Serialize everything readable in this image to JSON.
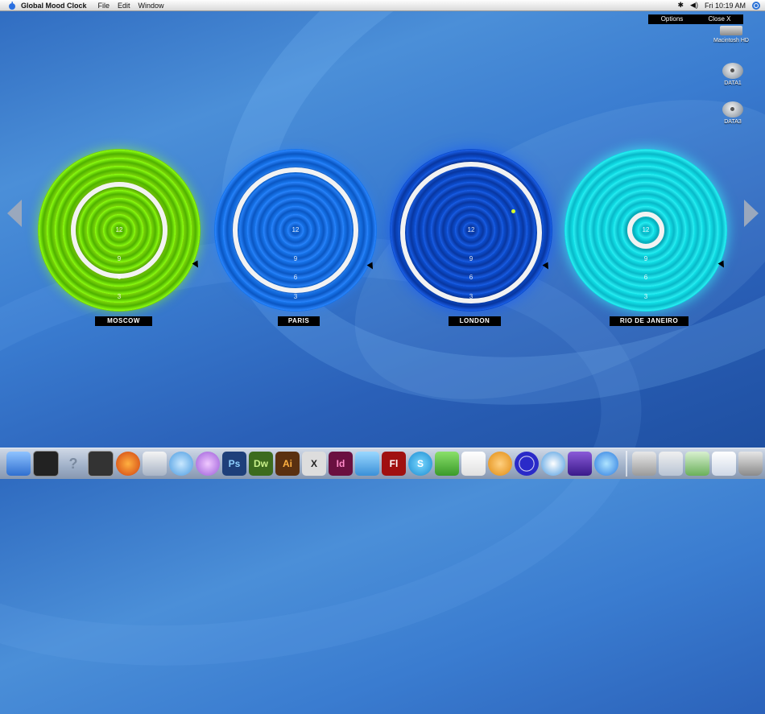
{
  "menubar": {
    "app_name": "Global Mood Clock",
    "menus": [
      "File",
      "Edit",
      "Window"
    ],
    "clock_text": "Fri 10:19 AM"
  },
  "controls": {
    "options_label": "Options",
    "close_label": "Close X"
  },
  "desktop_icons": [
    {
      "label": "Macintosh HD",
      "icon": "hard-drive-icon"
    },
    {
      "label": "DATA1",
      "icon": "disk-icon"
    },
    {
      "label": "DATA3",
      "icon": "disk-icon"
    }
  ],
  "clocks": [
    {
      "city": "MOSCOW",
      "numbers": [
        "12",
        "9",
        "6",
        "3"
      ],
      "color": "#7ed80a"
    },
    {
      "city": "PARIS",
      "numbers": [
        "12",
        "9",
        "6",
        "3"
      ],
      "color": "#1a78ef"
    },
    {
      "city": "LONDON",
      "numbers": [
        "12",
        "9",
        "6",
        "3"
      ],
      "color": "#0d4fd2"
    },
    {
      "city": "RIO DE JANEIRO",
      "numbers": [
        "12",
        "9",
        "6",
        "3"
      ],
      "color": "#14e4ea"
    }
  ],
  "dock": {
    "items": [
      {
        "icon": "finder-icon",
        "label": ""
      },
      {
        "icon": "terminal-icon",
        "label": ""
      },
      {
        "icon": "help-icon",
        "label": "?"
      },
      {
        "icon": "activity-monitor-icon",
        "label": ""
      },
      {
        "icon": "firefox-icon",
        "label": ""
      },
      {
        "icon": "preview-icon",
        "label": ""
      },
      {
        "icon": "itunes-icon",
        "label": ""
      },
      {
        "icon": "ichat-icon",
        "label": ""
      },
      {
        "icon": "photoshop-icon",
        "label": "Ps"
      },
      {
        "icon": "dreamweaver-icon",
        "label": "Dw"
      },
      {
        "icon": "illustrator-icon",
        "label": "Ai"
      },
      {
        "icon": "x11-icon",
        "label": "X"
      },
      {
        "icon": "indesign-icon",
        "label": "Id"
      },
      {
        "icon": "wave-icon",
        "label": ""
      },
      {
        "icon": "flash-icon",
        "label": "Fl"
      },
      {
        "icon": "skype-icon",
        "label": "S"
      },
      {
        "icon": "automator-icon",
        "label": ""
      },
      {
        "icon": "acrobat-icon",
        "label": ""
      },
      {
        "icon": "fireworks-icon",
        "label": ""
      },
      {
        "icon": "mood-clock-icon",
        "label": ""
      },
      {
        "icon": "safari-icon",
        "label": ""
      },
      {
        "icon": "imovie-icon",
        "label": ""
      },
      {
        "icon": "quicktime-icon",
        "label": ""
      }
    ],
    "right_items": [
      {
        "icon": "mail-icon",
        "label": ""
      },
      {
        "icon": "dashboard-icon",
        "label": ""
      },
      {
        "icon": "network-icon",
        "label": ""
      },
      {
        "icon": "documents-icon",
        "label": ""
      },
      {
        "icon": "trash-icon",
        "label": ""
      }
    ]
  }
}
